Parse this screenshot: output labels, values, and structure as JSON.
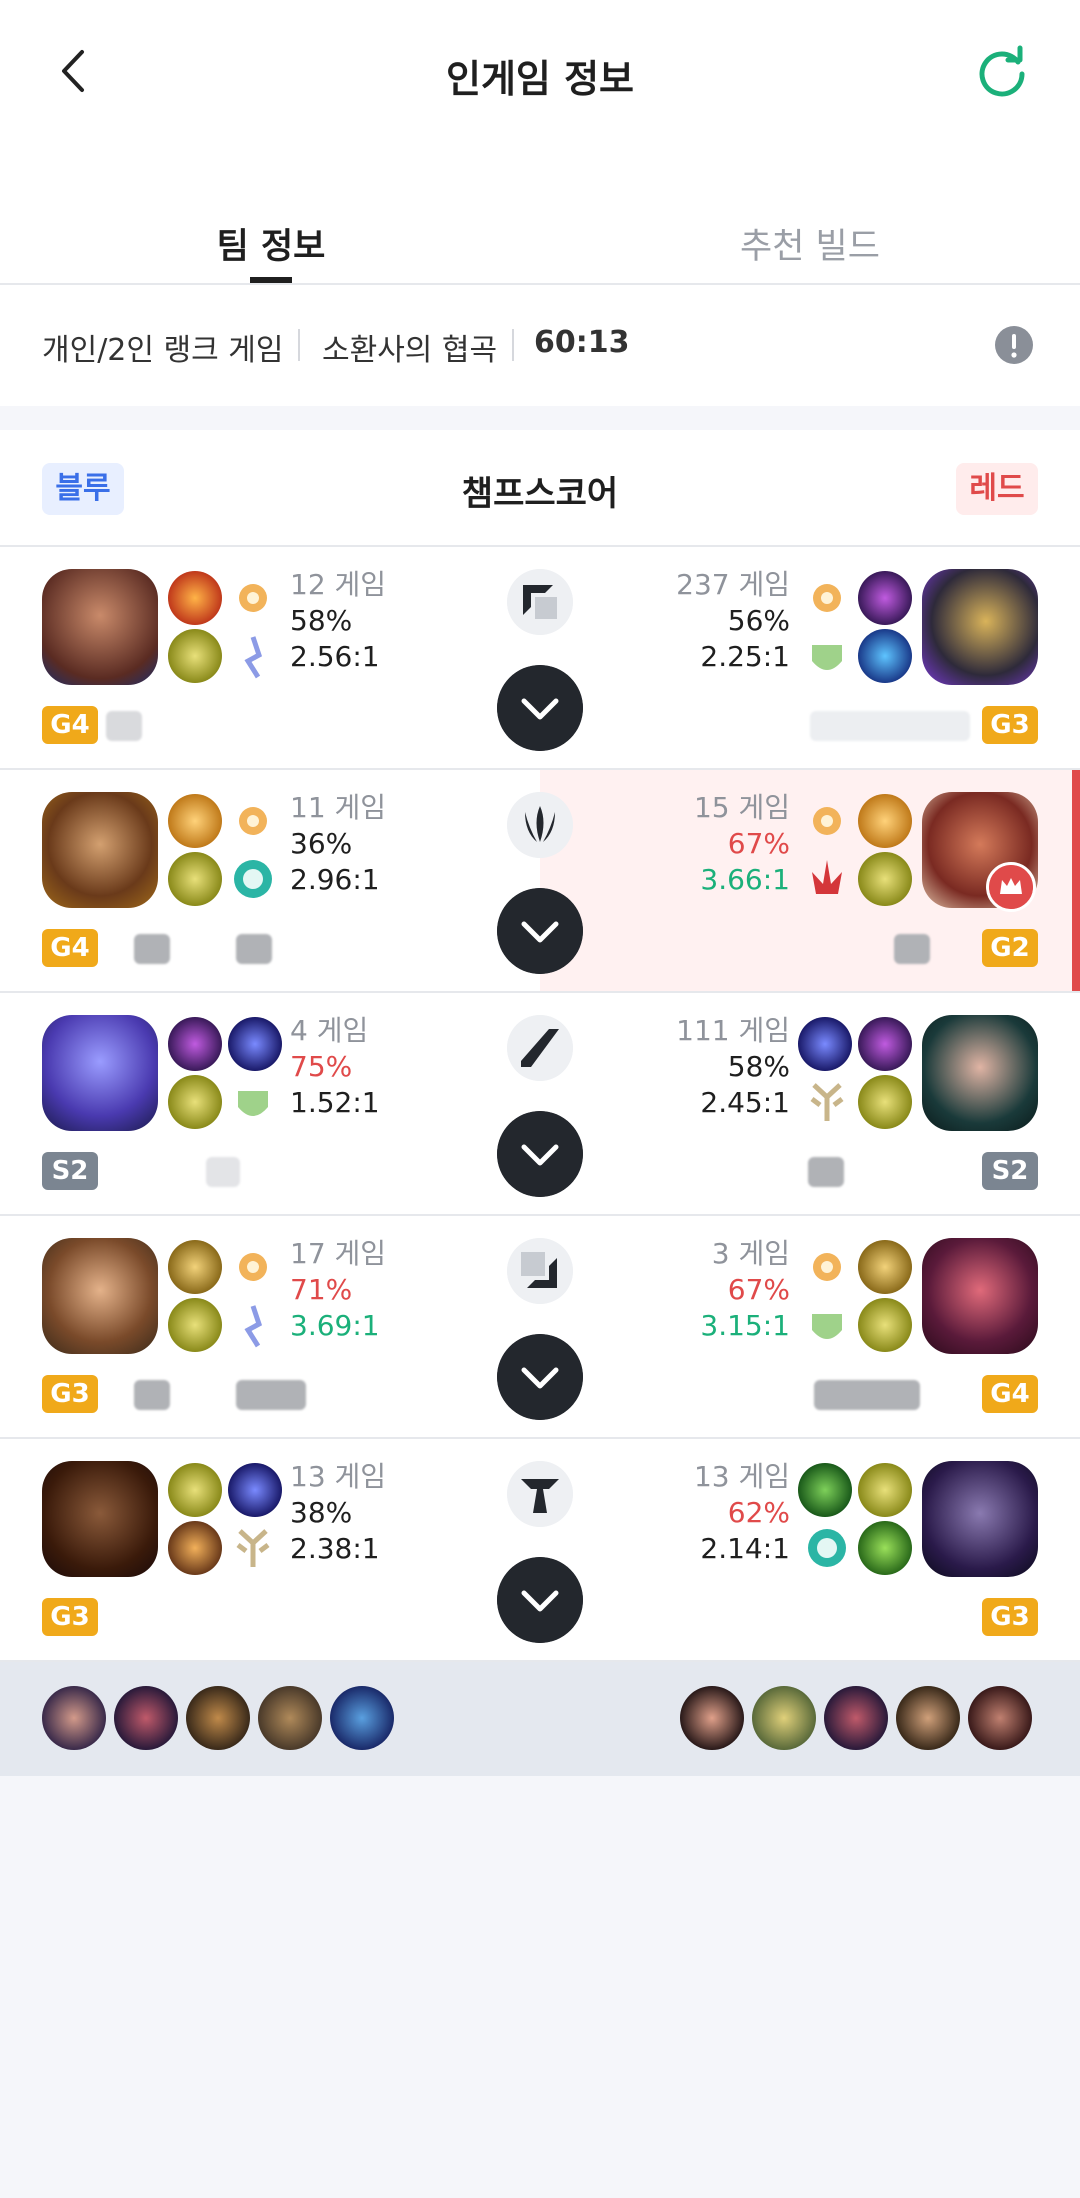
{
  "header": {
    "title": "인게임 정보",
    "back_icon": "back-arrow-icon",
    "refresh_icon": "refresh-icon"
  },
  "tabs": [
    {
      "label": "팀 정보",
      "active": true
    },
    {
      "label": "추천 빌드",
      "active": false
    }
  ],
  "info": {
    "queue": "개인/2인 랭크 게임",
    "map": "소환사의 협곡",
    "time": "60:13"
  },
  "score_header": {
    "blue": "블루",
    "title": "챔프스코어",
    "red": "레드"
  },
  "colors": {
    "blue_accent": "#3a6fe8",
    "red_accent": "#e04a4a",
    "green_accent": "#1bb07a",
    "gold_tier": "#f0a91a",
    "silver_tier": "#7b8591"
  },
  "rows": [
    {
      "lane": "top",
      "blue": {
        "games": "12 게임",
        "wr": "58%",
        "kda": "2.56:1",
        "tier": "G4"
      },
      "red": {
        "games": "237 게임",
        "wr": "56%",
        "kda": "2.25:1",
        "tier": "G3"
      }
    },
    {
      "lane": "jungle",
      "blue": {
        "games": "11 게임",
        "wr": "36%",
        "kda": "2.96:1",
        "tier": "G4"
      },
      "red": {
        "games": "15 게임",
        "wr": "67%",
        "kda": "3.66:1",
        "tier": "G2"
      }
    },
    {
      "lane": "mid",
      "blue": {
        "games": "4 게임",
        "wr": "75%",
        "kda": "1.52:1",
        "tier": "S2"
      },
      "red": {
        "games": "111 게임",
        "wr": "58%",
        "kda": "2.45:1",
        "tier": "S2"
      }
    },
    {
      "lane": "bottom",
      "blue": {
        "games": "17 게임",
        "wr": "71%",
        "kda": "3.69:1",
        "tier": "G3"
      },
      "red": {
        "games": "3 게임",
        "wr": "67%",
        "kda": "3.15:1",
        "tier": "G4"
      }
    },
    {
      "lane": "support",
      "blue": {
        "games": "13 게임",
        "wr": "38%",
        "kda": "2.38:1",
        "tier": "G3"
      },
      "red": {
        "games": "13 게임",
        "wr": "62%",
        "kda": "2.14:1",
        "tier": "G3"
      }
    }
  ]
}
